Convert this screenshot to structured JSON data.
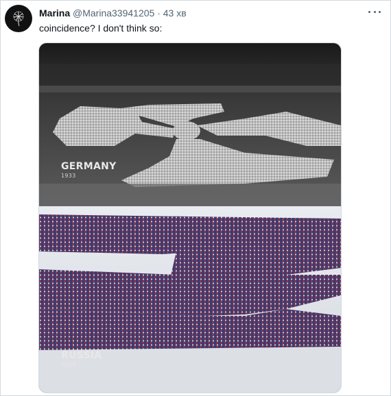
{
  "tweet": {
    "author_name": "Marina",
    "author_handle": "@Marina33941205",
    "separator": "·",
    "time": "43 хв",
    "text": "coincidence? I don't think so:"
  },
  "media": {
    "top_caption": {
      "country": "GERMANY",
      "year": "1933"
    },
    "bottom_caption": {
      "country": "RUSSIA",
      "year": "2024"
    }
  },
  "icons": {
    "avatar": "dandelion-icon",
    "more": "more-options-icon"
  },
  "colors": {
    "name": "#0f1419",
    "secondary": "#536471",
    "border": "#cfd9de"
  }
}
